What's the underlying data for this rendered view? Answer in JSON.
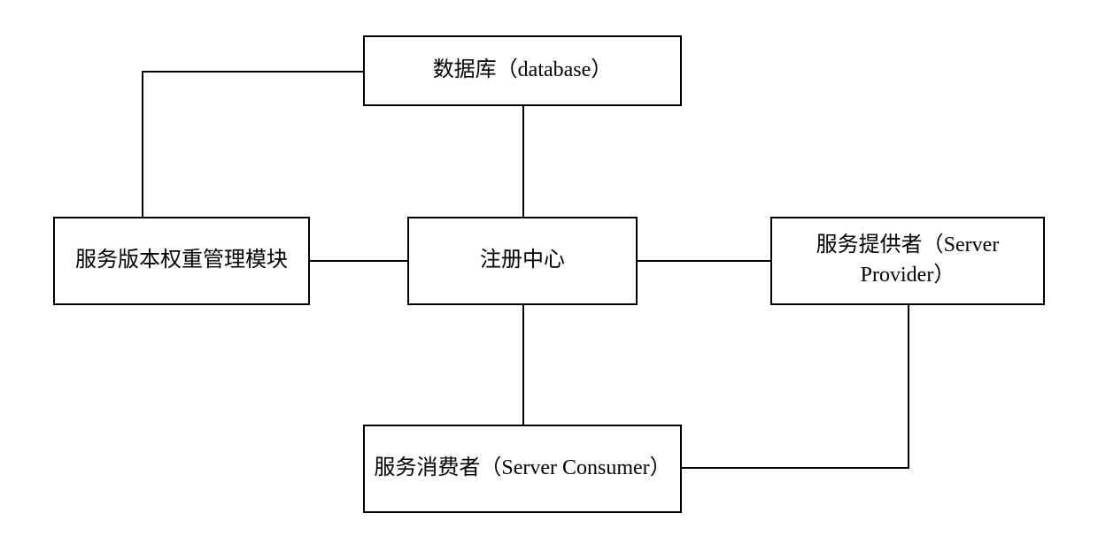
{
  "boxes": {
    "database": "数据库（database）",
    "weight_manager": "服务版本权重管理模块",
    "registry": "注册中心",
    "provider": "服务提供者（Server Provider）",
    "consumer": "服务消费者（Server Consumer）"
  }
}
